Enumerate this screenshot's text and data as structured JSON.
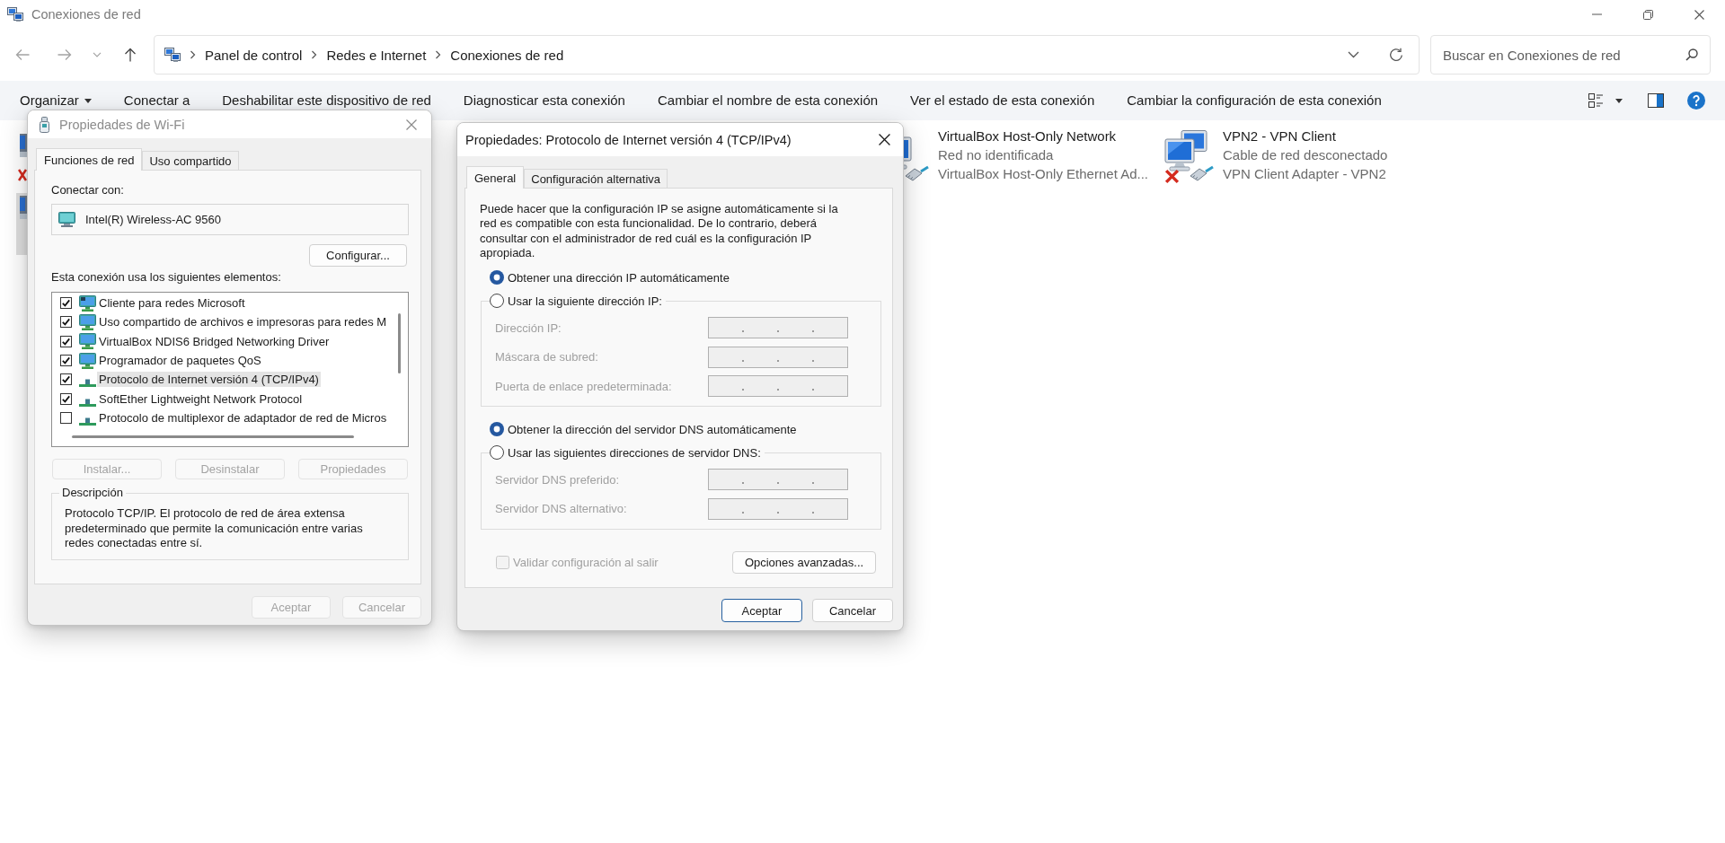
{
  "window": {
    "title": "Conexiones de red"
  },
  "address_bar": {
    "breadcrumbs": [
      "Panel de control",
      "Redes e Internet",
      "Conexiones de red"
    ]
  },
  "search": {
    "placeholder": "Buscar en Conexiones de red"
  },
  "toolbar": {
    "items": [
      {
        "label": "Organizar",
        "kind": "menu"
      },
      {
        "label": "Conectar a",
        "kind": "command"
      },
      {
        "label": "Deshabilitar este dispositivo de red",
        "kind": "command"
      },
      {
        "label": "Diagnosticar esta conexión",
        "kind": "command"
      },
      {
        "label": "Cambiar el nombre de esta conexión",
        "kind": "command"
      },
      {
        "label": "Ver el estado de esta conexión",
        "kind": "command"
      },
      {
        "label": "Cambiar la configuración de esta conexión",
        "kind": "command"
      }
    ]
  },
  "covered_connections": [
    {
      "disconnected": true,
      "selected": false
    },
    {
      "disconnected": false,
      "selected": true
    }
  ],
  "connections": [
    {
      "kind": "ethernet",
      "name": "VirtualBox Host-Only Network",
      "status": "Red no identificada",
      "adapter": "VirtualBox Host-Only Ethernet Ad...",
      "selected": false
    },
    {
      "kind": "vpn",
      "name": "VPN2 - VPN Client",
      "status": "Cable de red desconectado",
      "adapter": "VPN Client Adapter - VPN2",
      "disconnected": true,
      "selected": false
    }
  ],
  "wifi_dialog": {
    "title": "Propiedades de Wi-Fi",
    "active": false,
    "tabs": [
      {
        "label": "Funciones de red",
        "selected": true
      },
      {
        "label": "Uso compartido",
        "selected": false
      }
    ],
    "connect_label": "Conectar con:",
    "adapter": "Intel(R) Wireless-AC 9560",
    "configure_button": {
      "label": "Configurar...",
      "disabled": false
    },
    "components_label": "Esta conexión usa los siguientes elementos:",
    "components": [
      {
        "kind": "client",
        "label": "Cliente para redes Microsoft",
        "checked": true,
        "selected": false
      },
      {
        "kind": "service",
        "label": "Uso compartido de archivos e impresoras para redes M",
        "checked": true,
        "selected": false
      },
      {
        "kind": "service",
        "label": "VirtualBox NDIS6 Bridged Networking Driver",
        "checked": true,
        "selected": false
      },
      {
        "kind": "service",
        "label": "Programador de paquetes QoS",
        "checked": true,
        "selected": false
      },
      {
        "kind": "protocol",
        "label": "Protocolo de Internet versión 4 (TCP/IPv4)",
        "checked": true,
        "selected": true
      },
      {
        "kind": "protocol",
        "label": "SoftEther Lightweight Network Protocol",
        "checked": true,
        "selected": false
      },
      {
        "kind": "protocol",
        "label": "Protocolo de multiplexor de adaptador de red de Micros",
        "checked": false,
        "selected": false
      }
    ],
    "buttons": [
      {
        "label": "Instalar...",
        "disabled": true
      },
      {
        "label": "Desinstalar",
        "disabled": true
      },
      {
        "label": "Propiedades",
        "disabled": true
      }
    ],
    "description": {
      "title": "Descripción",
      "text": "Protocolo TCP/IP. El protocolo de red de área extensa predeterminado que permite la comunicación entre varias redes conectadas entre sí."
    },
    "footer_buttons": [
      {
        "label": "Aceptar",
        "disabled": true
      },
      {
        "label": "Cancelar",
        "disabled": true
      }
    ]
  },
  "ipv4_dialog": {
    "title": "Propiedades: Protocolo de Internet versión 4 (TCP/IPv4)",
    "active": true,
    "tabs": [
      {
        "label": "General",
        "selected": true
      },
      {
        "label": "Configuración alternativa",
        "selected": false
      }
    ],
    "intro": "Puede hacer que la configuración IP se asigne automáticamente si la red es compatible con esta funcionalidad. De lo contrario, deberá consultar con el administrador de red cuál es la configuración IP apropiada.",
    "ip_options": [
      {
        "label": "Obtener una dirección IP automáticamente",
        "selected": true
      },
      {
        "label": "Usar la siguiente dirección IP:",
        "selected": false
      }
    ],
    "ip_fields": [
      {
        "label": "Dirección IP:",
        "disabled": true
      },
      {
        "label": "Máscara de subred:",
        "disabled": true
      },
      {
        "label": "Puerta de enlace predeterminada:",
        "disabled": true
      }
    ],
    "dns_options": [
      {
        "label": "Obtener la dirección del servidor DNS automáticamente",
        "selected": true
      },
      {
        "label": "Usar las siguientes direcciones de servidor DNS:",
        "selected": false
      }
    ],
    "dns_fields": [
      {
        "label": "Servidor DNS preferido:",
        "disabled": true
      },
      {
        "label": "Servidor DNS alternativo:",
        "disabled": true
      }
    ],
    "validate": {
      "label": "Validar configuración al salir",
      "checked": false,
      "disabled": true
    },
    "advanced_button": {
      "label": "Opciones avanzadas...",
      "disabled": false
    },
    "footer_buttons": [
      {
        "label": "Aceptar",
        "default": true
      },
      {
        "label": "Cancelar",
        "default": false
      }
    ]
  }
}
